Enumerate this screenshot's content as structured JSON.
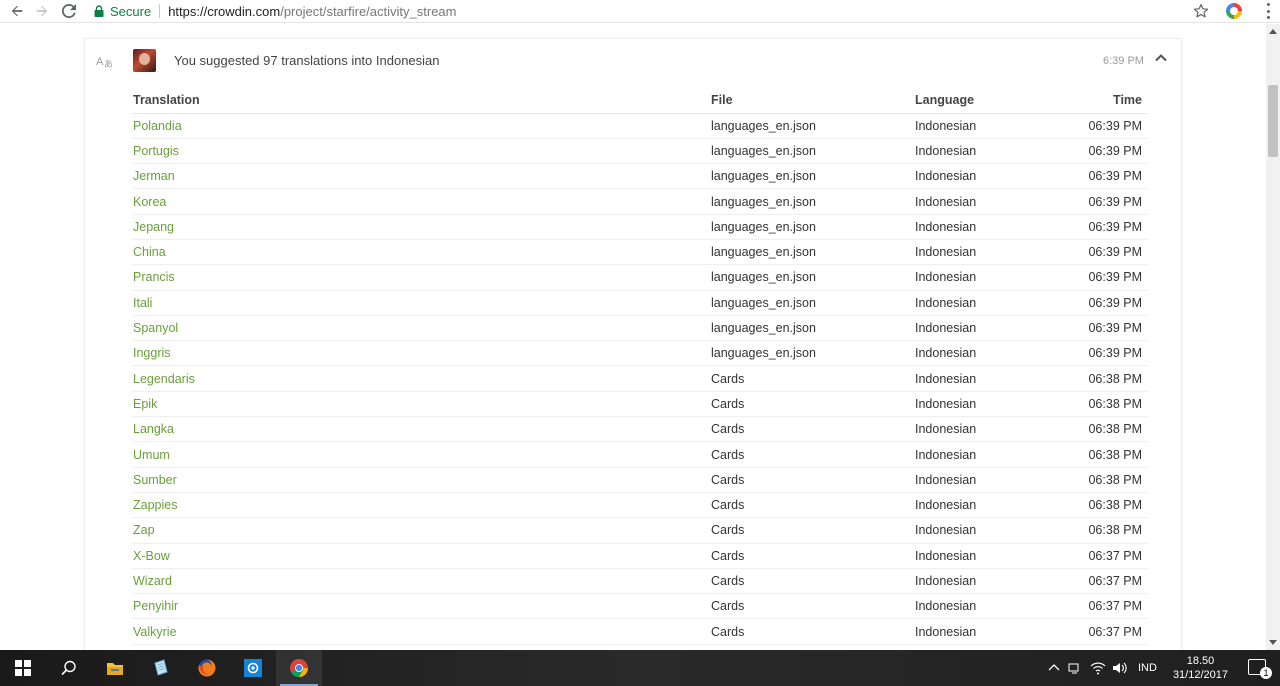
{
  "browser": {
    "secure_label": "Secure",
    "url_host": "https://crowdin.com",
    "url_path": "/project/starfire/activity_stream"
  },
  "activity": {
    "summary": "You suggested 97 translations into Indonesian",
    "time": "6:39 PM",
    "columns": {
      "translation": "Translation",
      "file": "File",
      "language": "Language",
      "time": "Time"
    },
    "rows": [
      {
        "translation": "Polandia",
        "file": "languages_en.json",
        "language": "Indonesian",
        "time": "06:39 PM"
      },
      {
        "translation": "Portugis",
        "file": "languages_en.json",
        "language": "Indonesian",
        "time": "06:39 PM"
      },
      {
        "translation": "Jerman",
        "file": "languages_en.json",
        "language": "Indonesian",
        "time": "06:39 PM"
      },
      {
        "translation": "Korea",
        "file": "languages_en.json",
        "language": "Indonesian",
        "time": "06:39 PM"
      },
      {
        "translation": "Jepang",
        "file": "languages_en.json",
        "language": "Indonesian",
        "time": "06:39 PM"
      },
      {
        "translation": "China",
        "file": "languages_en.json",
        "language": "Indonesian",
        "time": "06:39 PM"
      },
      {
        "translation": "Prancis",
        "file": "languages_en.json",
        "language": "Indonesian",
        "time": "06:39 PM"
      },
      {
        "translation": "Itali",
        "file": "languages_en.json",
        "language": "Indonesian",
        "time": "06:39 PM"
      },
      {
        "translation": "Spanyol",
        "file": "languages_en.json",
        "language": "Indonesian",
        "time": "06:39 PM"
      },
      {
        "translation": "Inggris",
        "file": "languages_en.json",
        "language": "Indonesian",
        "time": "06:39 PM"
      },
      {
        "translation": "Legendaris",
        "file": "Cards",
        "language": "Indonesian",
        "time": "06:38 PM"
      },
      {
        "translation": "Epik",
        "file": "Cards",
        "language": "Indonesian",
        "time": "06:38 PM"
      },
      {
        "translation": "Langka",
        "file": "Cards",
        "language": "Indonesian",
        "time": "06:38 PM"
      },
      {
        "translation": "Umum",
        "file": "Cards",
        "language": "Indonesian",
        "time": "06:38 PM"
      },
      {
        "translation": "Sumber",
        "file": "Cards",
        "language": "Indonesian",
        "time": "06:38 PM"
      },
      {
        "translation": "Zappies",
        "file": "Cards",
        "language": "Indonesian",
        "time": "06:38 PM"
      },
      {
        "translation": "Zap",
        "file": "Cards",
        "language": "Indonesian",
        "time": "06:38 PM"
      },
      {
        "translation": "X-Bow",
        "file": "Cards",
        "language": "Indonesian",
        "time": "06:37 PM"
      },
      {
        "translation": "Wizard",
        "file": "Cards",
        "language": "Indonesian",
        "time": "06:37 PM"
      },
      {
        "translation": "Penyihir",
        "file": "Cards",
        "language": "Indonesian",
        "time": "06:37 PM"
      },
      {
        "translation": "Valkyrie",
        "file": "Cards",
        "language": "Indonesian",
        "time": "06:37 PM"
      }
    ]
  },
  "taskbar": {
    "language": "IND",
    "time": "18.50",
    "date": "31/12/2017",
    "notification_count": "1"
  },
  "colors": {
    "link_green": "#6a9f3c",
    "secure_green": "#0b8043"
  }
}
